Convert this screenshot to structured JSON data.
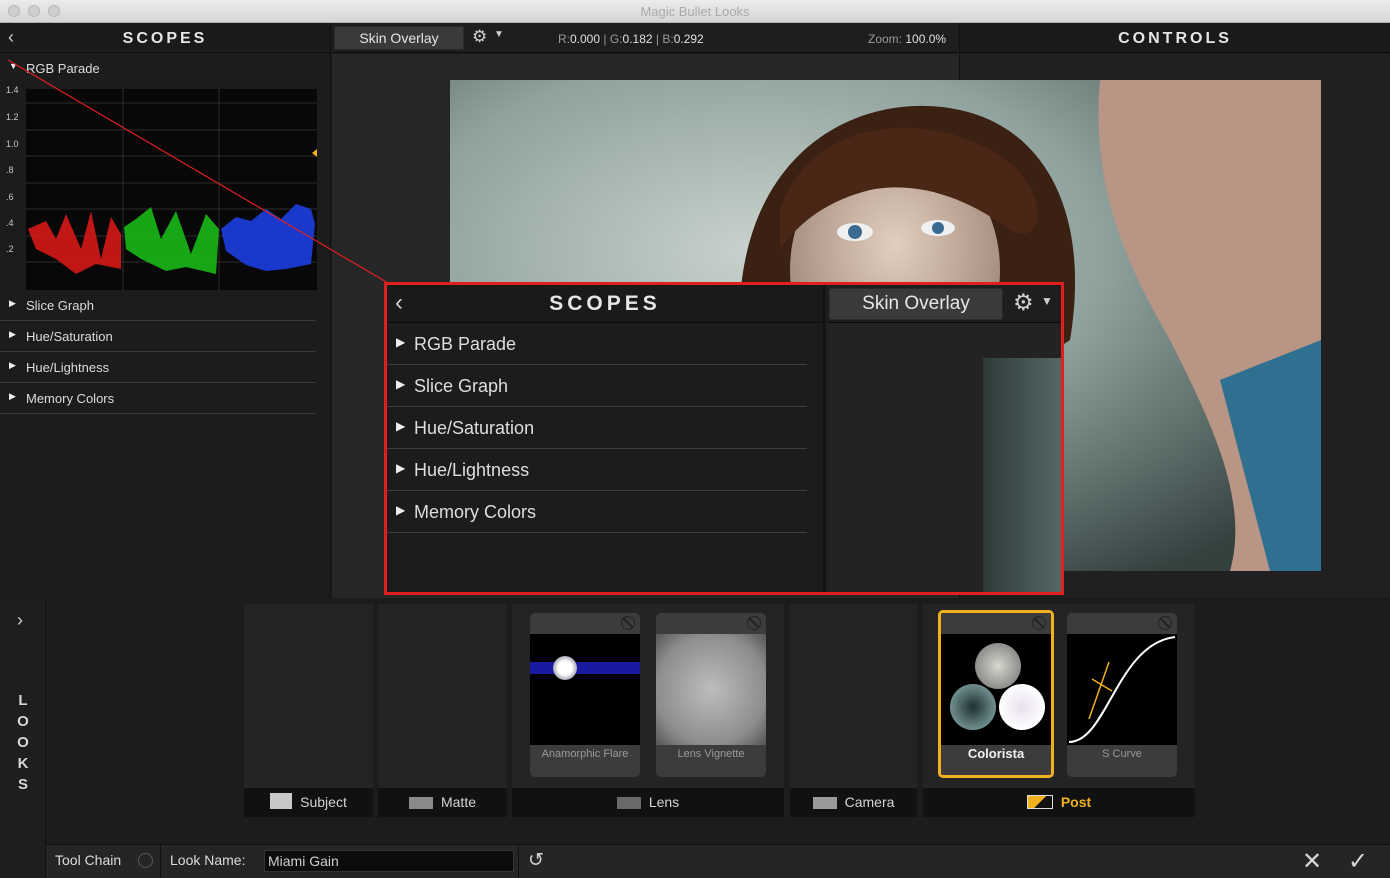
{
  "window": {
    "title": "Magic Bullet Looks"
  },
  "scopes": {
    "title": "SCOPES",
    "items": [
      {
        "label": "RGB Parade",
        "expanded": true
      },
      {
        "label": "Slice Graph"
      },
      {
        "label": "Hue/Saturation"
      },
      {
        "label": "Hue/Lightness"
      },
      {
        "label": "Memory Colors"
      }
    ],
    "parade_ticks": [
      "1.4",
      "1.2",
      "1.0",
      ".8",
      ".6",
      ".4",
      ".2"
    ]
  },
  "viewer": {
    "overlay_button": "Skin Overlay",
    "readout": {
      "r_label": "R:",
      "r": "0.000",
      "g_label": "G:",
      "g": "0.182",
      "b_label": "B:",
      "b": "0.292",
      "sep": "|"
    },
    "zoom_label": "Zoom:",
    "zoom": "100.0%"
  },
  "controls": {
    "title": "CONTROLS"
  },
  "callout": {
    "title": "SCOPES",
    "overlay_button": "Skin Overlay",
    "items": [
      "RGB Parade",
      "Slice Graph",
      "Hue/Saturation",
      "Hue/Lightness",
      "Memory Colors"
    ]
  },
  "looks": {
    "side_label": [
      "L",
      "O",
      "O",
      "K",
      "S"
    ],
    "categories": [
      "Subject",
      "Matte",
      "Lens",
      "Camera",
      "Post"
    ],
    "tools": [
      {
        "name": "Anamorphic Flare"
      },
      {
        "name": "Lens Vignette"
      },
      {
        "name": "Colorista",
        "selected": true
      },
      {
        "name": "S Curve"
      }
    ]
  },
  "bottombar": {
    "tool_chain": "Tool Chain",
    "look_name_label": "Look Name:",
    "look_name_value": "Miami Gain"
  },
  "colors": {
    "accent": "#f0b020",
    "callout_border": "#e02020"
  }
}
